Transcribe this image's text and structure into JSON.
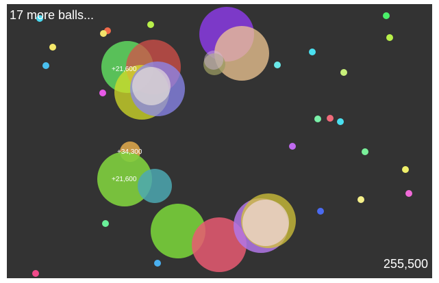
{
  "hud": {
    "remaining": "17 more balls...",
    "score": "255,500"
  },
  "colors": {
    "background": "#333333",
    "text": "#ffffff"
  },
  "popups": [
    "+21,600",
    "+34,300",
    "+21,600"
  ]
}
